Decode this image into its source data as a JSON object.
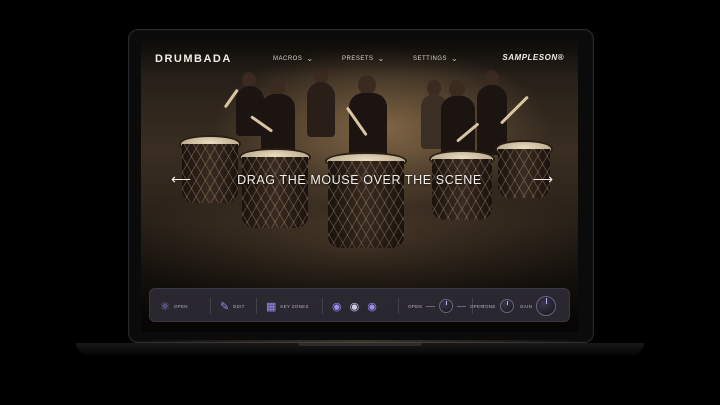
{
  "app": {
    "logo": "DRUMBADA",
    "brand": "SAMPLESON®"
  },
  "nav": {
    "items": [
      {
        "label": "MACROS"
      },
      {
        "label": "PRESETS"
      },
      {
        "label": "SETTINGS"
      }
    ]
  },
  "scene": {
    "instruction": "DRAG THE MOUSE OVER THE SCENE"
  },
  "controls": {
    "ensemble_label": "OPEN",
    "edit_label": "EDIT",
    "keymap_label": "KEY ZONES",
    "attack_label": "OPEN",
    "release_label": "OPEN",
    "tone_label": "TONE",
    "gain_label": "GAIN"
  },
  "icons": {
    "ensemble": "group-icon",
    "edit": "pencil-icon",
    "keymap": "keymap-icon",
    "drum1": "drum-icon",
    "drum2": "drum-icon",
    "drum3": "drum-icon"
  },
  "colors": {
    "accent": "#9b8cf2",
    "bar_bg": "#2d2a34"
  }
}
